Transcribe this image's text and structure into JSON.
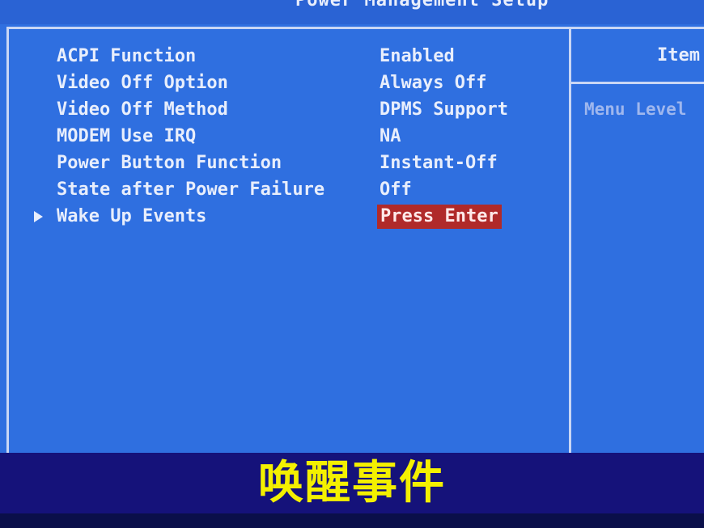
{
  "window": {
    "title": "Power Management Setup"
  },
  "settings": [
    {
      "label": "ACPI Function",
      "value": "Enabled"
    },
    {
      "label": "Video Off Option",
      "value": "Always Off"
    },
    {
      "label": "Video Off Method",
      "value": "DPMS Support"
    },
    {
      "label": "MODEM Use IRQ",
      "value": "NA"
    },
    {
      "label": "Power Button Function",
      "value": "Instant-Off"
    },
    {
      "label": "State after Power Failure",
      "value": "Off"
    },
    {
      "label": "Wake Up Events",
      "value": "Press Enter",
      "selected": true
    }
  ],
  "help_panel": {
    "title": "Item",
    "menu_level": "Menu Level"
  },
  "subtitle": "唤醒事件",
  "colors": {
    "background": "#2f6fe0",
    "text": "#e8eefc",
    "highlight": "#b02a2a",
    "subtitle_band": "#15127a",
    "subtitle_text": "#f4f000"
  }
}
